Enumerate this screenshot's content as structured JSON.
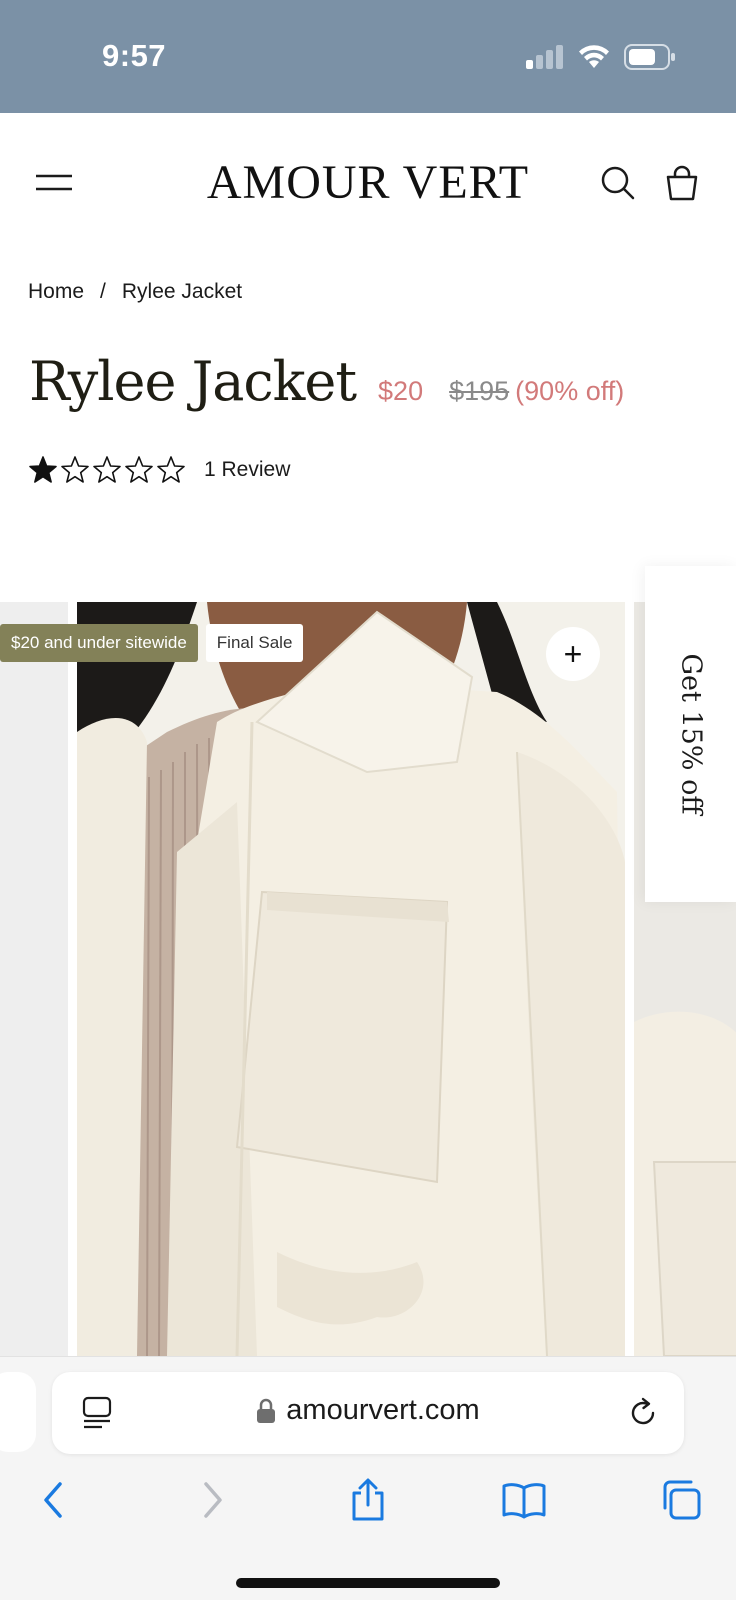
{
  "status_bar": {
    "time": "9:57",
    "icons": [
      "signal-icon",
      "wifi-icon",
      "battery-icon"
    ]
  },
  "header": {
    "brand": "AMOUR VERT",
    "icons": [
      "menu-icon",
      "search-icon",
      "shopping-bag-icon"
    ]
  },
  "breadcrumb": {
    "home": "Home",
    "separator": "/",
    "current": "Rylee Jacket"
  },
  "product": {
    "title": "Rylee Jacket",
    "sale_price": "$20",
    "original_price": "$195",
    "discount": "(90% off)",
    "rating": 1,
    "rating_max": 5,
    "review_count": "1 Review"
  },
  "gallery": {
    "badges": [
      "$20 and under sitewide",
      "Final Sale"
    ],
    "zoom_label": "+"
  },
  "promo_tab": {
    "text": "Get 15% off"
  },
  "browser": {
    "url": "amourvert.com",
    "icons": [
      "reader-icon",
      "lock-icon",
      "reload-icon",
      "back-icon",
      "forward-icon",
      "share-icon",
      "bookmarks-icon",
      "tabs-icon"
    ]
  },
  "colors": {
    "status_bar": "#7b91a6",
    "sale": "#d27a7a",
    "promo_badge": "#838158",
    "browser_accent": "#1a7ae0"
  }
}
